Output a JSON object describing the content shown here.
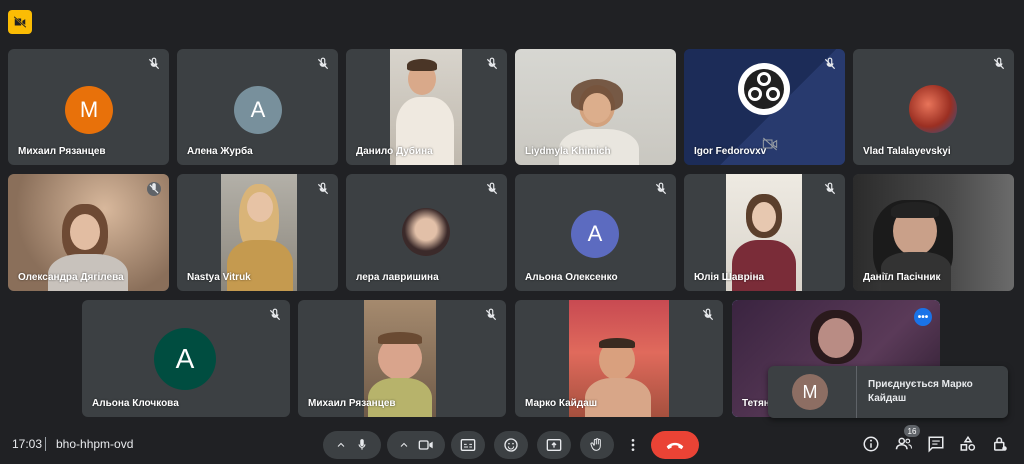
{
  "app": {
    "accent": "#8ab4f8",
    "tile_bg": "#3c4043",
    "page_bg": "#202124",
    "hangup_color": "#ea4335"
  },
  "tiles": [
    {
      "name": "Михаил Рязанцев",
      "avatar_letter": "М",
      "avatar_color": "#e8710a",
      "muted": true
    },
    {
      "name": "Алена Журба",
      "avatar_letter": "А",
      "avatar_color": "#78909c",
      "muted": true
    },
    {
      "name": "Данило Дубина",
      "muted": true
    },
    {
      "name": "Liydmyla Khimich",
      "muted": false
    },
    {
      "name": "Igor Fedorovxv",
      "muted": true
    },
    {
      "name": "Vlad Talalayevskyi",
      "muted": true
    },
    {
      "name": "Олександра Дягілева",
      "muted": true
    },
    {
      "name": "Nastya Vitruk",
      "muted": true
    },
    {
      "name": "лера лавришина",
      "muted": true
    },
    {
      "name": "Альона Олексенко",
      "avatar_letter": "А",
      "avatar_color": "#5c6bc0",
      "muted": true
    },
    {
      "name": "Юлія Шаврінa",
      "muted": true
    },
    {
      "name": "Даніїл Пасічник",
      "muted": false
    },
    {
      "name": "Альона Клочкова",
      "avatar_letter": "А",
      "avatar_color": "#004d40",
      "muted": true
    },
    {
      "name": "Михаил Рязанцев",
      "muted": true
    },
    {
      "name": "Марко Кайдаш",
      "muted": true
    },
    {
      "name": "Тетян",
      "muted": false,
      "active": true
    }
  ],
  "toast": {
    "avatar_letter": "М",
    "text": "Приєднується Марко Кайдаш"
  },
  "bottom": {
    "time": "17:03",
    "meeting_code": "bho-hhpm-ovd",
    "participants_count": "16"
  },
  "icons": {
    "top": "camera-off-icon",
    "mute": "mic-off-icon",
    "controls": [
      "chevron-up-icon",
      "mic-icon",
      "chevron-up-icon",
      "camera-icon",
      "captions-icon",
      "emoji-icon",
      "present-icon",
      "raise-hand-icon",
      "more-vert-icon",
      "call-end-icon"
    ],
    "right": [
      "info-icon",
      "people-icon",
      "chat-icon",
      "activities-icon",
      "host-controls-icon"
    ]
  }
}
